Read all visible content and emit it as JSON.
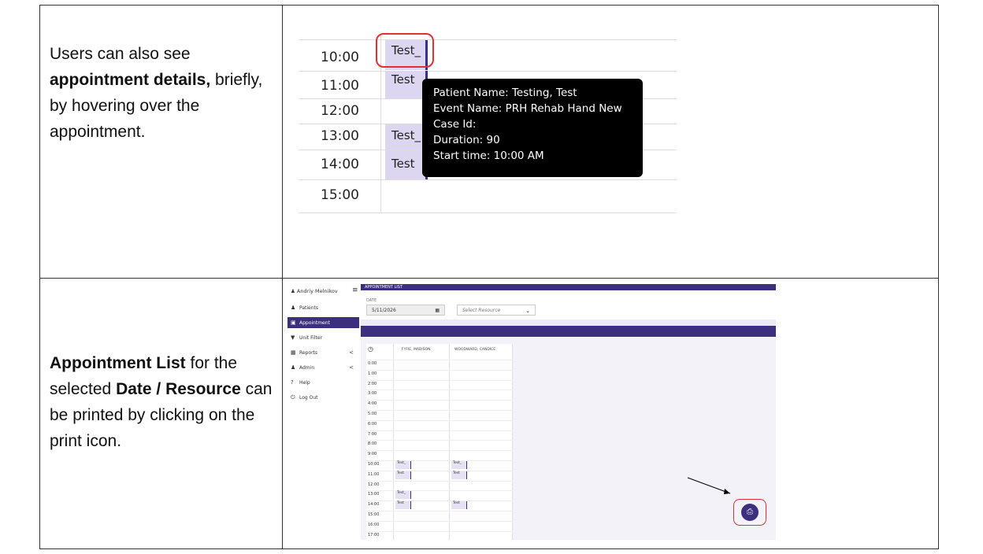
{
  "row1": {
    "text_parts": [
      "Users can also see ",
      "appointment details,",
      " briefly, by hovering over the appointment."
    ],
    "times": [
      "10:00",
      "11:00",
      "12:00",
      "13:00",
      "14:00",
      "15:00"
    ],
    "events": [
      "Test_",
      "Test",
      "Test_",
      "Test"
    ],
    "tooltip": {
      "patient": "Patient Name: Testing, Test",
      "event": "Event Name: PRH Rehab Hand New",
      "case": "Case Id:",
      "duration": "Duration: 90",
      "start": "Start time: 10:00 AM"
    },
    "highlight_color": "#e03030",
    "event_bg": "#dcd6f0"
  },
  "row2": {
    "text_parts": [
      " Appointment List",
      " for the selected ",
      "Date / Resource",
      " can be printed by clicking on the print icon."
    ],
    "app": {
      "user": "Andriy Melnikov",
      "menu_icon": "hamburger-icon",
      "sidebar": [
        {
          "label": "Patients",
          "icon": "users-icon"
        },
        {
          "label": "Appointment",
          "icon": "calendar-icon",
          "active": true
        },
        {
          "label": "Unit Filter",
          "icon": "filter-icon"
        },
        {
          "label": "Reports",
          "icon": "report-icon",
          "chevron": "<"
        },
        {
          "label": "Admin",
          "icon": "user-icon",
          "chevron": "<"
        },
        {
          "label": "Help",
          "icon": "question-icon"
        },
        {
          "label": "Log Out",
          "icon": "power-icon"
        }
      ],
      "header_title": "APPOINTMENT LIST",
      "date_label": "DATE",
      "date_value": "5/11/2026",
      "resource_placeholder": "Select Resource",
      "columns": [
        "FYFIE, MADISON",
        "WOODWARD, CANDICE"
      ],
      "times": [
        "0:00",
        "1:00",
        "2:00",
        "3:00",
        "4:00",
        "5:00",
        "6:00",
        "7:00",
        "8:00",
        "9:00",
        "10:00",
        "11:00",
        "12:00",
        "13:00",
        "14:00",
        "15:00",
        "16:00",
        "17:00"
      ],
      "events_col1": [
        "Test_",
        "Test",
        "Test_",
        "Test"
      ],
      "events_col2": [
        "Test_",
        "Test",
        "Test"
      ],
      "brand_color": "#3b2f7e",
      "print_icon": "print-icon"
    }
  }
}
